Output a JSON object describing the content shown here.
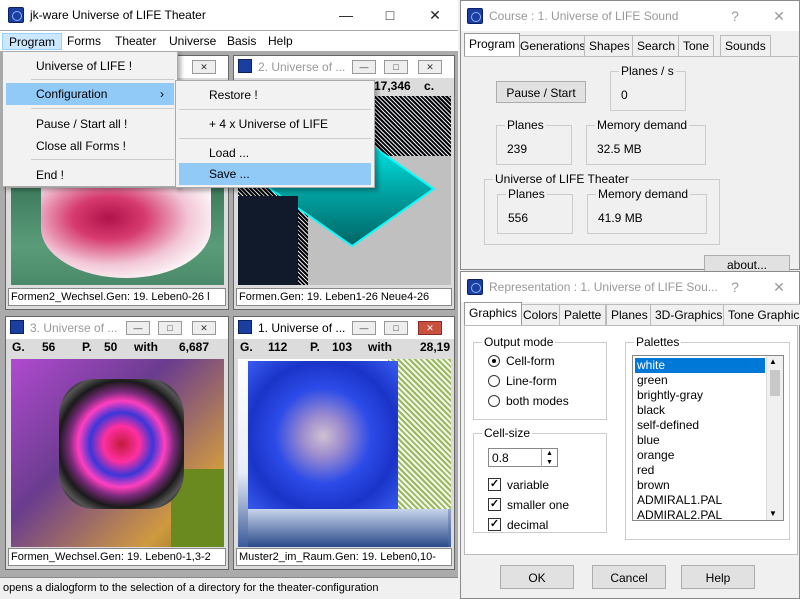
{
  "main": {
    "title": "jk-ware Universe of LIFE Theater",
    "menu": [
      "Program",
      "Forms",
      "Theater",
      "Universe",
      "Basis",
      "Help"
    ],
    "program_menu": [
      "Universe of LIFE !",
      "Configuration",
      "Pause / Start all !",
      "Close all Forms !",
      "End !"
    ],
    "config_menu": [
      "Restore !",
      "+ 4 x Universe of LIFE",
      "Load ...",
      "Save ..."
    ],
    "status": "opens a dialogform to the selection of a directory for the theater-configuration"
  },
  "children": [
    {
      "title": "2. Universe of ...",
      "gen_right": "17,346",
      "gen_unit": "c.",
      "caption": "Formen.Gen: 19. Leben1-26 Neue4-26"
    },
    {
      "title": "",
      "caption": "Formen2_Wechsel.Gen: 19. Leben0-26 l"
    },
    {
      "title": "3. Universe of ...",
      "g": "G.",
      "g_val": "56",
      "p": "P.",
      "p_val": "50",
      "with": "with",
      "count": "6,687",
      "caption": "Formen_Wechsel.Gen: 19. Leben0-1,3-2"
    },
    {
      "title": "1. Universe of ...",
      "g": "G.",
      "g_val": "112",
      "p": "P.",
      "p_val": "103",
      "with": "with",
      "count": "28,19",
      "caption": "Muster2_im_Raum.Gen: 19. Leben0,10-"
    }
  ],
  "course": {
    "title": "Course : 1. Universe of LIFE Sound",
    "tabs": [
      "Program",
      "Generations",
      "Shapes",
      "Search",
      "Tone",
      "Sounds"
    ],
    "pause_button": "Pause / Start",
    "planes_per_s_label": "Planes / s",
    "planes_per_s": "0",
    "planes_label": "Planes",
    "planes": "239",
    "memory_label": "Memory demand",
    "memory": "32.5 MB",
    "theater_group": "Universe of LIFE Theater",
    "theater_planes_label": "Planes",
    "theater_planes": "556",
    "theater_memory_label": "Memory demand",
    "theater_memory": "41.9 MB",
    "about_button": "about..."
  },
  "representation": {
    "title": "Representation : 1. Universe of LIFE Sou...",
    "tabs": [
      "Graphics",
      "Colors",
      "Palette",
      "Planes",
      "3D-Graphics",
      "Tone Graphics"
    ],
    "output_mode_label": "Output mode",
    "output_modes": [
      "Cell-form",
      "Line-form",
      "both modes"
    ],
    "cell_size_label": "Cell-size",
    "cell_size": "0.8",
    "checks": [
      "variable",
      "smaller one",
      "decimal"
    ],
    "palettes_label": "Palettes",
    "palettes": [
      "white",
      "green",
      "brightly-gray",
      "black",
      "self-defined",
      "blue",
      "orange",
      "red",
      "brown",
      "ADMIRAL1.PAL",
      "ADMIRAL2.PAL"
    ],
    "ok": "OK",
    "cancel": "Cancel",
    "help": "Help"
  },
  "colors": {
    "selection": "#0078d7",
    "menu_highlight": "#91c9f7"
  }
}
